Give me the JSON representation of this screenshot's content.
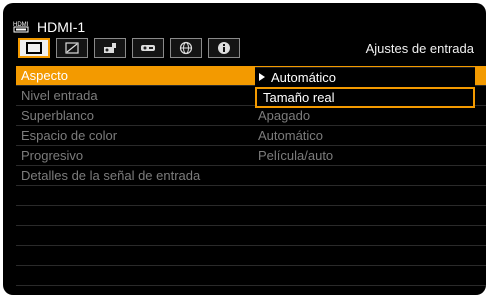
{
  "header": {
    "source_icon": "hdmi-connector-icon",
    "source_label": "HDMI-1"
  },
  "tabs": [
    {
      "icon": "image-adjust-icon",
      "active": true
    },
    {
      "icon": "picture-quality-icon",
      "active": false
    },
    {
      "icon": "installation-icon",
      "active": false
    },
    {
      "icon": "system-settings-icon",
      "active": false
    },
    {
      "icon": "network-globe-icon",
      "active": false
    },
    {
      "icon": "info-icon",
      "active": false
    }
  ],
  "tab_title": "Ajustes de entrada",
  "menu": {
    "items": [
      {
        "label": "Aspecto",
        "value": "Automático",
        "selected": true
      },
      {
        "label": "Nivel entrada",
        "value": ""
      },
      {
        "label": "Superblanco",
        "value": "Apagado"
      },
      {
        "label": "Espacio de color",
        "value": "Automático"
      },
      {
        "label": "Progresivo",
        "value": "Película/auto"
      },
      {
        "label": "Detalles de la señal de entrada",
        "value": ""
      }
    ]
  },
  "dropdown": {
    "options": [
      "Automático",
      "Tamaño real"
    ],
    "current": "Automático",
    "highlighted": "Tamaño real"
  },
  "colors": {
    "accent": "#f39a00",
    "background": "#000000",
    "text_active": "#ffffff",
    "text_inactive": "#7c7c7c"
  }
}
